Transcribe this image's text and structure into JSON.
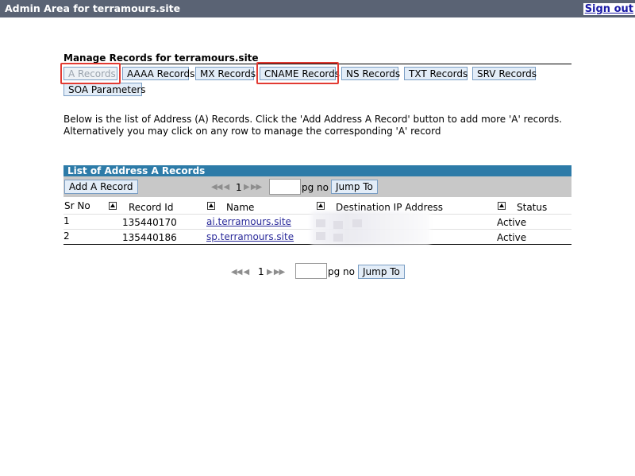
{
  "header": {
    "title": "Admin Area for terramours.site",
    "signout_label": "Sign out"
  },
  "page": {
    "heading": "Manage Records for terramours.site",
    "tabs": [
      {
        "label": "A Records",
        "disabled": true,
        "highlighted": true
      },
      {
        "label": "AAAA Records"
      },
      {
        "label": "MX Records"
      },
      {
        "label": "CNAME Records",
        "highlighted": true
      },
      {
        "label": "NS Records"
      },
      {
        "label": "TXT Records"
      },
      {
        "label": "SRV Records"
      },
      {
        "label": "SOA Parameters"
      }
    ],
    "description": "Below is the list of Address (A) Records. Click the 'Add Address A Record' button to add more 'A' records. Alternatively you may click on any row to manage the corresponding 'A' record"
  },
  "list": {
    "title": "List of Address A Records",
    "add_button": "Add A Record",
    "pager": {
      "page": "1",
      "pg_no_label": "pg no",
      "jump_label": "Jump To"
    },
    "columns": [
      "Sr No",
      "Record Id",
      "Name",
      "Destination IP Address",
      "Status"
    ],
    "rows": [
      {
        "sr": "1",
        "record_id": "135440170",
        "name": "ai.terramours.site",
        "dest": "",
        "status": "Active"
      },
      {
        "sr": "2",
        "record_id": "135440186",
        "name": "sp.terramours.site",
        "dest": "",
        "status": "Active"
      }
    ]
  },
  "bottom_pager": {
    "page": "1",
    "pg_no_label": "pg no",
    "jump_label": "Jump To"
  }
}
